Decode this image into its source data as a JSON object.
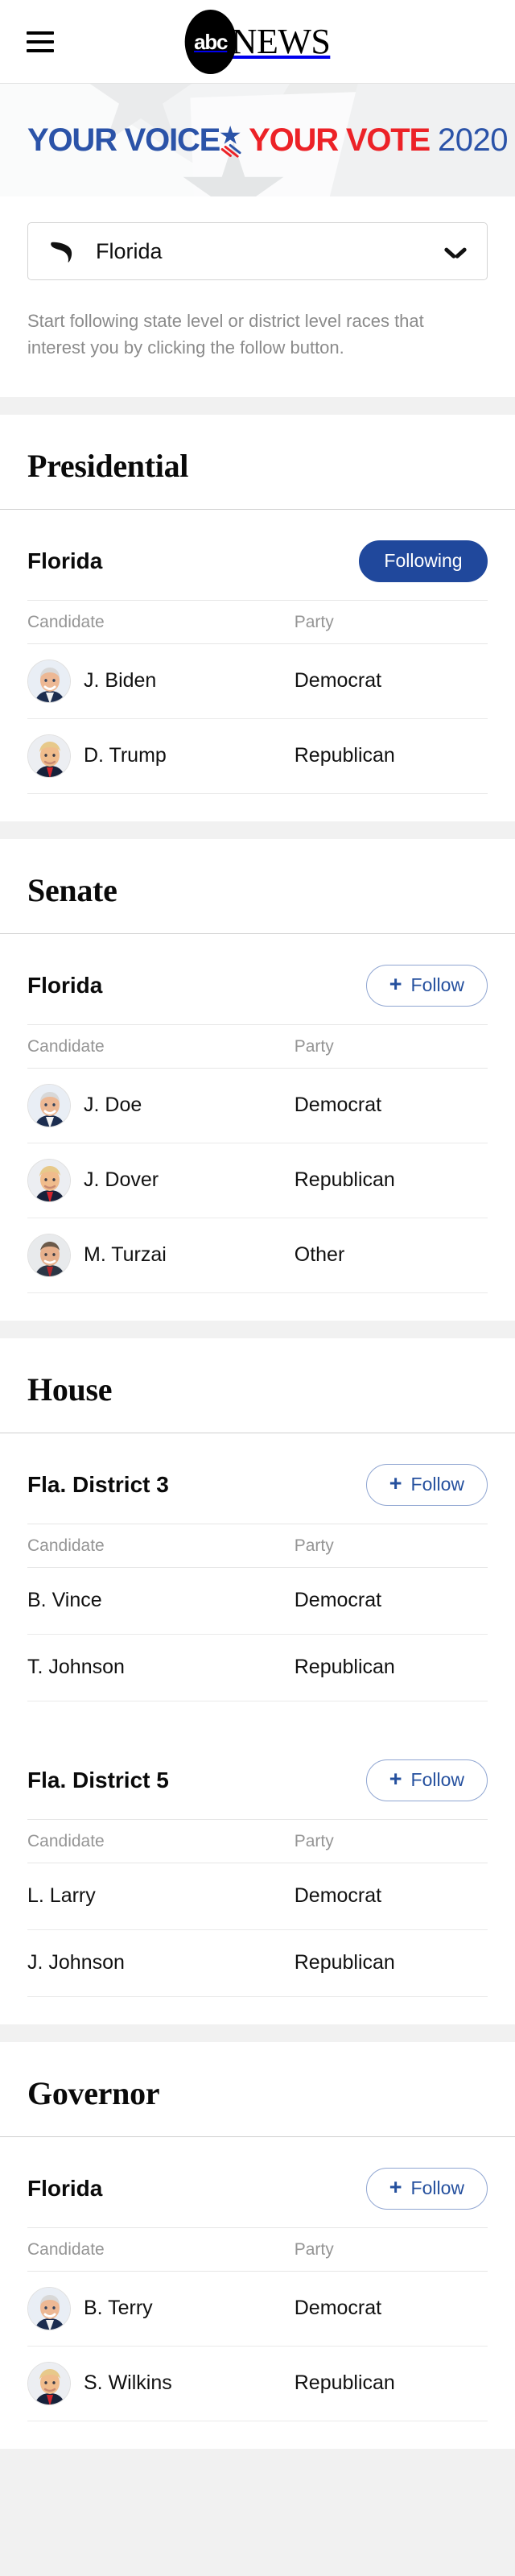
{
  "header": {
    "menu_icon": "hamburger-menu-icon",
    "brand_mark": "abc",
    "brand_word": "NEWS"
  },
  "banner": {
    "text_part1": "YOUR VOICE",
    "star_icon": "star-swoosh-icon",
    "text_part2": "YOUR VOTE",
    "year": "2020"
  },
  "state_selector": {
    "icon": "florida-state-shape-icon",
    "selected": "Florida",
    "chevron": "chevron-down-icon"
  },
  "helper_text": "Start following state level or district level races that interest you by clicking the follow button.",
  "colors": {
    "following_bg": "#20489c",
    "follow_border": "#8fa5d1",
    "follow_text": "#25509e",
    "banner_blue": "#2b53a8",
    "banner_red": "#ec2227",
    "separator": "#f1f1f1"
  },
  "table_headers": {
    "candidate": "Candidate",
    "party": "Party"
  },
  "buttons": {
    "follow": "Follow",
    "following": "Following",
    "plus": "+"
  },
  "sections": [
    {
      "title": "Presidential",
      "races": [
        {
          "name": "Florida",
          "follow_state": "following",
          "follow_label": "Following",
          "show_avatars": true,
          "candidates": [
            {
              "name": "J. Biden",
              "party": "Democrat",
              "avatar": "candidate-avatar-biden"
            },
            {
              "name": "D. Trump",
              "party": "Republican",
              "avatar": "candidate-avatar-trump"
            }
          ]
        }
      ]
    },
    {
      "title": "Senate",
      "races": [
        {
          "name": "Florida",
          "follow_state": "follow",
          "follow_label": "Follow",
          "show_avatars": true,
          "candidates": [
            {
              "name": "J. Doe",
              "party": "Democrat",
              "avatar": "candidate-avatar-biden"
            },
            {
              "name": "J. Dover",
              "party": "Republican",
              "avatar": "candidate-avatar-trump"
            },
            {
              "name": "M. Turzai",
              "party": "Other",
              "avatar": "candidate-avatar-turzai"
            }
          ]
        }
      ]
    },
    {
      "title": "House",
      "races": [
        {
          "name": "Fla. District 3",
          "follow_state": "follow",
          "follow_label": "Follow",
          "show_avatars": false,
          "candidates": [
            {
              "name": "B. Vince",
              "party": "Democrat",
              "avatar": ""
            },
            {
              "name": "T. Johnson",
              "party": "Republican",
              "avatar": ""
            }
          ]
        },
        {
          "name": "Fla. District 5",
          "follow_state": "follow",
          "follow_label": "Follow",
          "show_avatars": false,
          "candidates": [
            {
              "name": "L. Larry",
              "party": "Democrat",
              "avatar": ""
            },
            {
              "name": "J. Johnson",
              "party": "Republican",
              "avatar": ""
            }
          ]
        }
      ]
    },
    {
      "title": "Governor",
      "races": [
        {
          "name": "Florida",
          "follow_state": "follow",
          "follow_label": "Follow",
          "show_avatars": true,
          "candidates": [
            {
              "name": "B. Terry",
              "party": "Democrat",
              "avatar": "candidate-avatar-biden"
            },
            {
              "name": "S. Wilkins",
              "party": "Republican",
              "avatar": "candidate-avatar-trump"
            }
          ]
        }
      ]
    }
  ]
}
